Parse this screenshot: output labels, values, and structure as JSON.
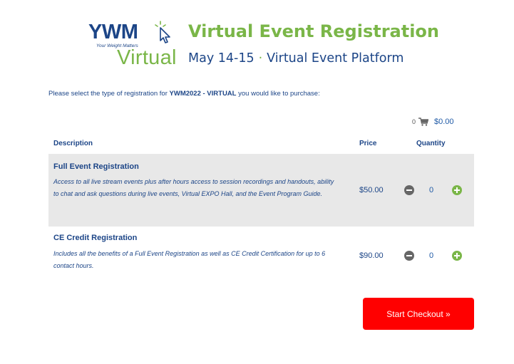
{
  "logo": {
    "brand": "YWM",
    "tagline": "Your Weight Matters",
    "sub": "Virtual"
  },
  "hero": {
    "title": "Virtual Event Registration",
    "date": "May 14-15",
    "separator": "·",
    "venue": "Virtual Event Platform"
  },
  "intro": {
    "prefix": "Please select the type of registration for ",
    "event_code": "YWM2022 - VIRTUAL",
    "suffix": " you would like to purchase:"
  },
  "cart": {
    "count": "0",
    "total": "$0.00",
    "icon": "cart-icon"
  },
  "table": {
    "headers": {
      "description": "Description",
      "price": "Price",
      "quantity": "Quantity"
    },
    "items": [
      {
        "name": "Full Event Registration",
        "description": "Access to all live stream events plus after hours access to session recordings and handouts, ability to chat and ask questions during live events, Virtual EXPO Hall, and the Event Program Guide.",
        "price": "$50.00",
        "quantity": "0"
      },
      {
        "name": "CE Credit Registration",
        "description": "Includes all the benefits of a Full Event Registration as well as CE Credit Certification for up to 6 contact hours.",
        "price": "$90.00",
        "quantity": "0"
      }
    ]
  },
  "checkout": {
    "label": "Start Checkout »"
  },
  "colors": {
    "brand_blue": "#1c4587",
    "brand_green": "#7ab648",
    "checkout_red": "#ff0000",
    "row_shade": "#e8e8e8"
  }
}
